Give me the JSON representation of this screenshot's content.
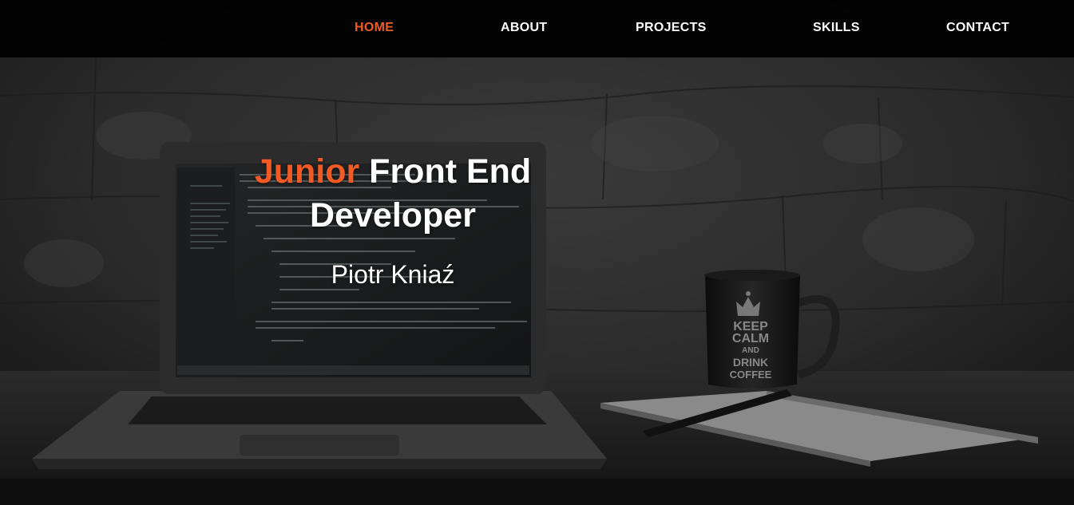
{
  "colors": {
    "accent": "#f15a24",
    "text": "#ffffff",
    "navbar_bg": "#000000"
  },
  "nav": {
    "items": [
      {
        "label": "HOME",
        "active": true
      },
      {
        "label": "ABOUT",
        "active": false
      },
      {
        "label": "PROJECTS",
        "active": false
      },
      {
        "label": "SKILLS",
        "active": false
      },
      {
        "label": "CONTACT",
        "active": false
      }
    ]
  },
  "hero": {
    "title_accent": "Junior",
    "title_rest": "Front End Developer",
    "name": "Piotr Kniaź",
    "background": "desk-with-laptop-and-keep-calm-mug-photo"
  },
  "mug": {
    "lines": [
      "KEEP",
      "CALM",
      "AND",
      "DRINK",
      "COFFEE"
    ]
  }
}
